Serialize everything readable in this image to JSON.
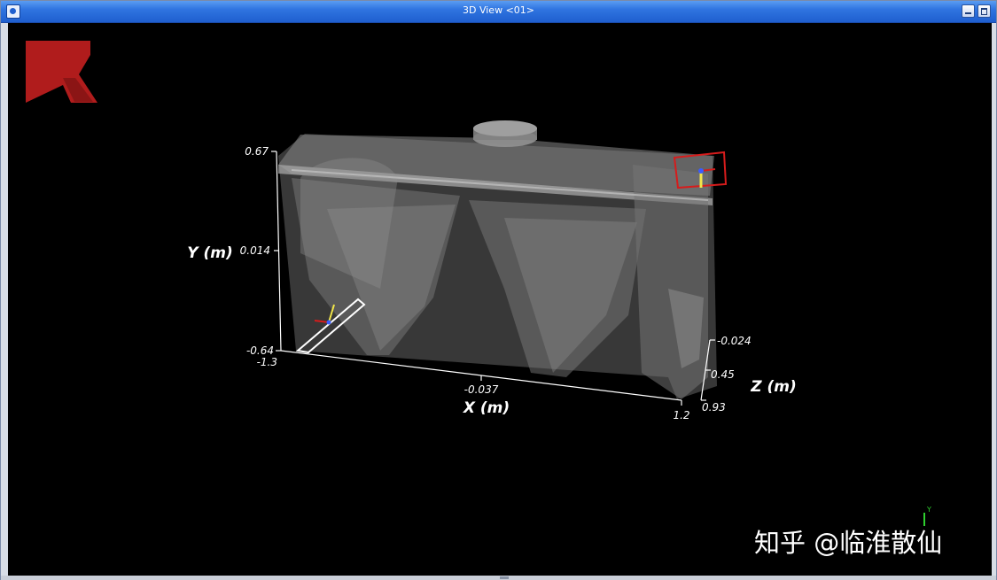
{
  "window": {
    "title": "3D View <01>",
    "app_icon": "app-icon",
    "buttons": {
      "minimize": "minimize-icon",
      "maximize": "maximize-icon"
    }
  },
  "viewport": {
    "background": "#000000",
    "logo": {
      "icon": "brand-logo",
      "color": "#b01c1c"
    },
    "axes": {
      "x": {
        "label": "X (m)",
        "ticks": [
          "-1.3",
          "-0.037",
          "1.2"
        ]
      },
      "y": {
        "label": "Y (m)",
        "ticks": [
          "0.67",
          "0.014",
          "-0.64"
        ]
      },
      "z": {
        "label": "Z (m)",
        "ticks": [
          "-0.024",
          "0.45",
          "0.93"
        ]
      }
    },
    "orientation_triad": {
      "icon": "axes-triad-icon",
      "label": "Y"
    },
    "watermark": "知乎 @临淮散仙"
  }
}
